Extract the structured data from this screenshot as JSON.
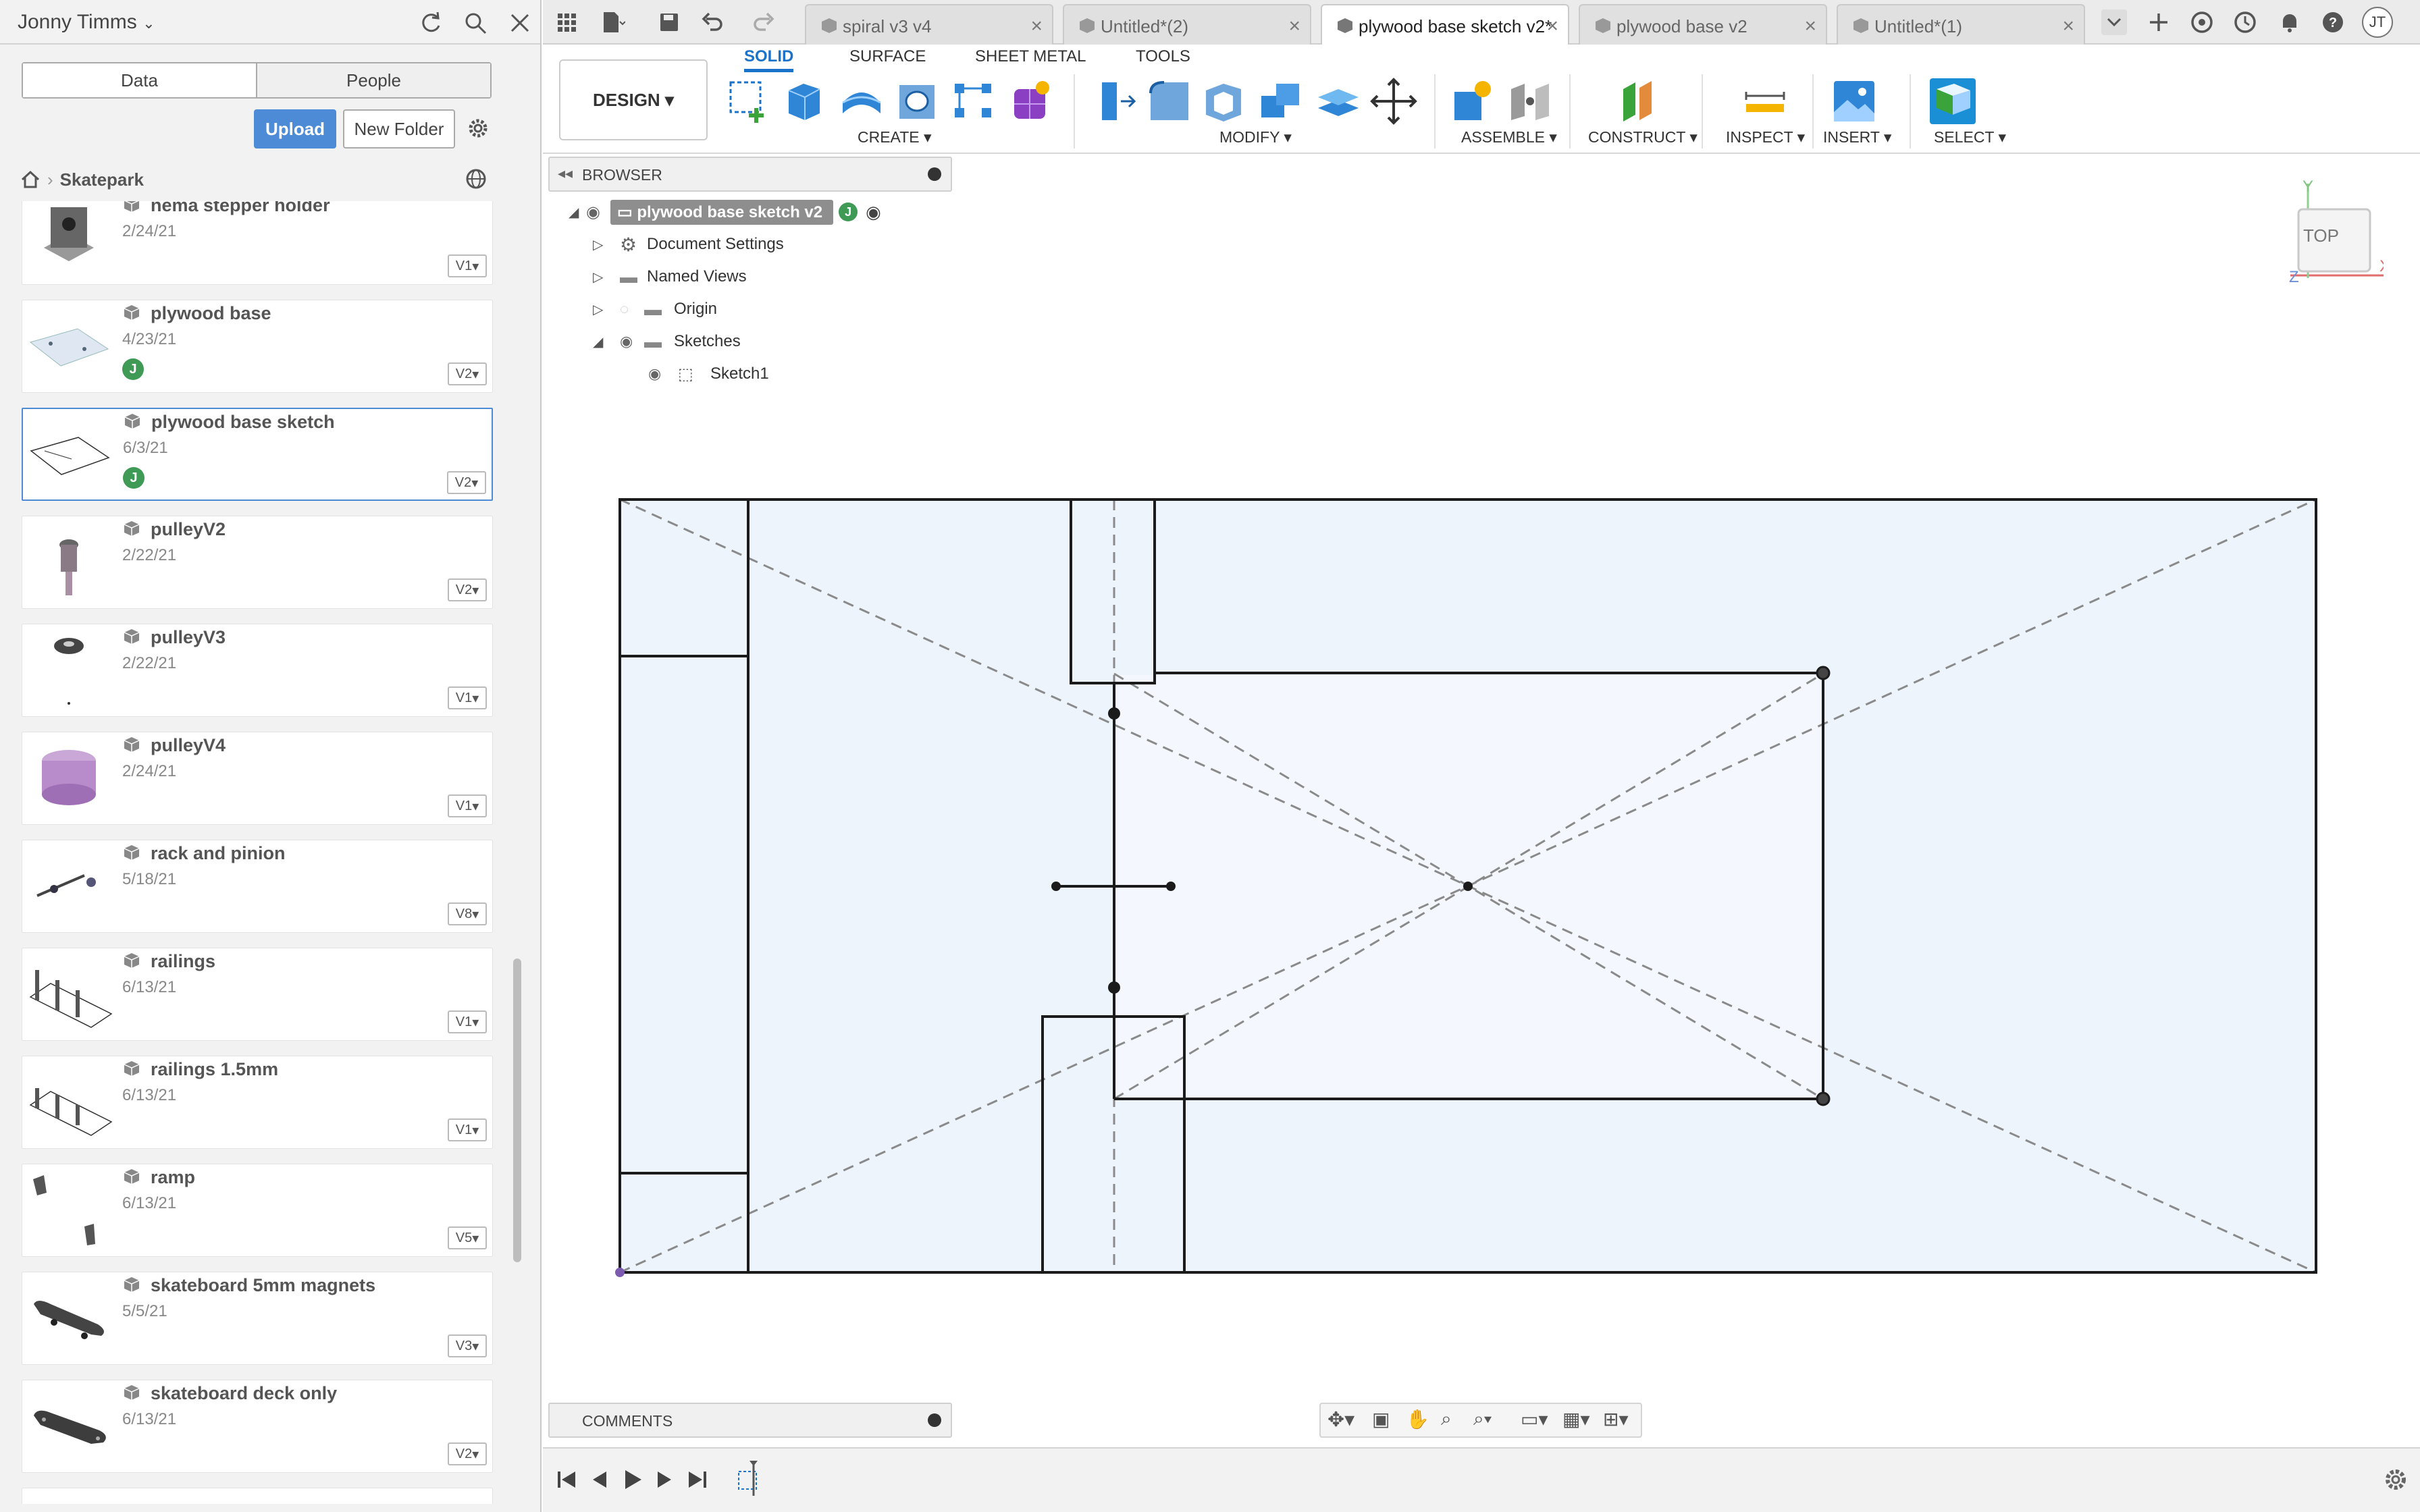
{
  "data_panel": {
    "user_name": "Jonny Timms",
    "tabs": [
      "Data",
      "People"
    ],
    "upload_label": "Upload",
    "new_folder_label": "New Folder",
    "breadcrumb": "Skatepark",
    "files": [
      {
        "name": "nema stepper holder",
        "date": "2/24/21",
        "version": "V1",
        "avatar": ""
      },
      {
        "name": "plywood base",
        "date": "4/23/21",
        "version": "V2",
        "avatar": "J"
      },
      {
        "name": "plywood base sketch",
        "date": "6/3/21",
        "version": "V2",
        "avatar": "J"
      },
      {
        "name": "pulleyV2",
        "date": "2/22/21",
        "version": "V2",
        "avatar": ""
      },
      {
        "name": "pulleyV3",
        "date": "2/22/21",
        "version": "V1",
        "avatar": ""
      },
      {
        "name": "pulleyV4",
        "date": "2/24/21",
        "version": "V1",
        "avatar": ""
      },
      {
        "name": "rack and pinion",
        "date": "5/18/21",
        "version": "V8",
        "avatar": ""
      },
      {
        "name": "railings",
        "date": "6/13/21",
        "version": "V1",
        "avatar": ""
      },
      {
        "name": "railings 1.5mm",
        "date": "6/13/21",
        "version": "V1",
        "avatar": ""
      },
      {
        "name": "ramp",
        "date": "6/13/21",
        "version": "V5",
        "avatar": ""
      },
      {
        "name": "skateboard 5mm magnets",
        "date": "5/5/21",
        "version": "V3",
        "avatar": ""
      },
      {
        "name": "skateboard deck only",
        "date": "6/13/21",
        "version": "V2",
        "avatar": ""
      }
    ]
  },
  "doc_tabs": [
    {
      "label": "spiral v3 v4"
    },
    {
      "label": "Untitled*(2)"
    },
    {
      "label": "plywood base sketch v2*"
    },
    {
      "label": "plywood base v2"
    },
    {
      "label": "Untitled*(1)"
    }
  ],
  "user_initials": "JT",
  "ribbon": {
    "design_label": "DESIGN ▾",
    "tabs": [
      "SOLID",
      "SURFACE",
      "SHEET METAL",
      "TOOLS"
    ],
    "groups": [
      "CREATE ▾",
      "MODIFY ▾",
      "ASSEMBLE ▾",
      "CONSTRUCT ▾",
      "INSPECT ▾",
      "INSERT ▾",
      "SELECT ▾"
    ]
  },
  "browser": {
    "label": "BROWSER",
    "root": "plywood base sketch v2",
    "root_avatar": "J",
    "items": [
      "Document Settings",
      "Named Views",
      "Origin",
      "Sketches",
      "Sketch1"
    ]
  },
  "comments_label": "COMMENTS",
  "viewcube_label": "TOP",
  "axis_labels": {
    "x": "X",
    "y": "Y",
    "z": "Z"
  },
  "colors": {
    "accent": "#1a73c9",
    "upload": "#4d8bd6",
    "sketch_fill": "#e8f1fb",
    "avatar_green": "#3f9a55"
  }
}
